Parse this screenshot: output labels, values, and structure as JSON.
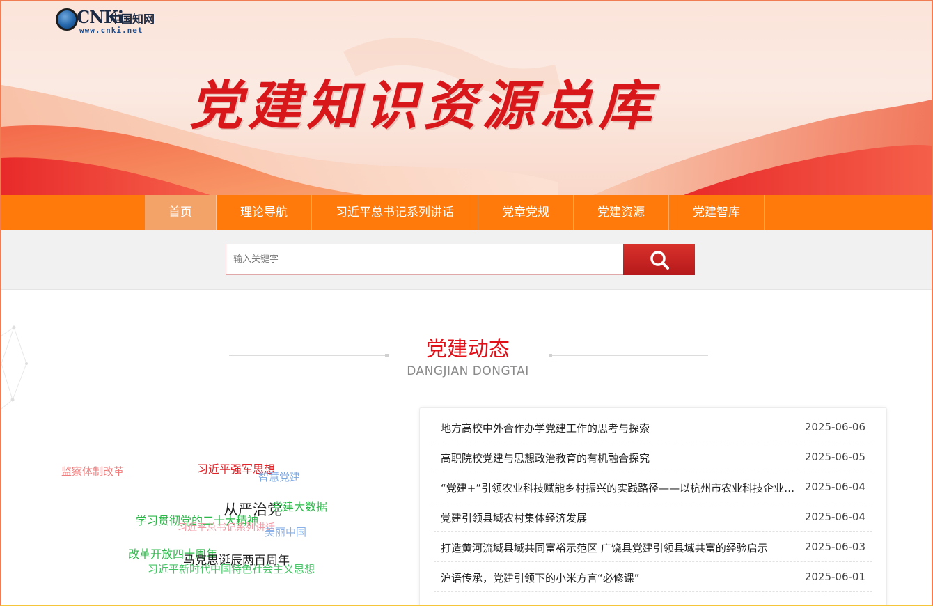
{
  "logo": {
    "brand": "CNKi",
    "cn_name": "中国知网",
    "url": "www.cnki.net"
  },
  "banner": {
    "title": "党建知识资源总库"
  },
  "nav": {
    "items": [
      {
        "label": "首页",
        "active": true
      },
      {
        "label": "理论导航",
        "active": false
      },
      {
        "label": "习近平总书记系列讲话",
        "active": false
      },
      {
        "label": "党章党规",
        "active": false
      },
      {
        "label": "党建资源",
        "active": false
      },
      {
        "label": "党建智库",
        "active": false
      }
    ]
  },
  "search": {
    "placeholder": "输入关键字",
    "value": "",
    "button_icon": "search-icon"
  },
  "section": {
    "title": "党建动态",
    "subtitle": "DANGJIAN DONGTAI"
  },
  "tag_cloud": [
    {
      "text": "监察体制改革",
      "color": "#f07b7b"
    },
    {
      "text": "习近平强军思想",
      "color": "#e0242a"
    },
    {
      "text": "智慧党建",
      "color": "#7aa6e0"
    },
    {
      "text": "从严治党",
      "color": "#1f1f1f"
    },
    {
      "text": "党建大数据",
      "color": "#2db84a"
    },
    {
      "text": "学习贯彻党的二十大精神",
      "color": "#2db84a"
    },
    {
      "text": "习近平总书记系列讲话",
      "color": "#f09aa5"
    },
    {
      "text": "美丽中国",
      "color": "#8bb2e8"
    },
    {
      "text": "改革开放四十周年",
      "color": "#2db84a"
    },
    {
      "text": "马克思诞辰两百周年",
      "color": "#1f1f1f"
    },
    {
      "text": "习近平新时代中国特色社会主义思想",
      "color": "#44c464"
    }
  ],
  "news": [
    {
      "title": "地方高校中外合作办学党建工作的思考与探索",
      "date": "2025-06-06"
    },
    {
      "title": "高职院校党建与思想政治教育的有机融合探究",
      "date": "2025-06-05"
    },
    {
      "title": "“党建+”引领农业科技赋能乡村振兴的实践路径——以杭州市农业科技企业为例",
      "date": "2025-06-04"
    },
    {
      "title": "党建引领县域农村集体经济发展",
      "date": "2025-06-04"
    },
    {
      "title": "打造黄河流域县域共同富裕示范区 广饶县党建引领县域共富的经验启示",
      "date": "2025-06-03"
    },
    {
      "title": "沪语传承，党建引领下的小米方言“必修课”",
      "date": "2025-06-01"
    }
  ],
  "colors": {
    "nav_bg": "#ff7a0a",
    "nav_active": "#f3a368",
    "accent_red": "#e1111a",
    "search_button": "#c8221f"
  }
}
